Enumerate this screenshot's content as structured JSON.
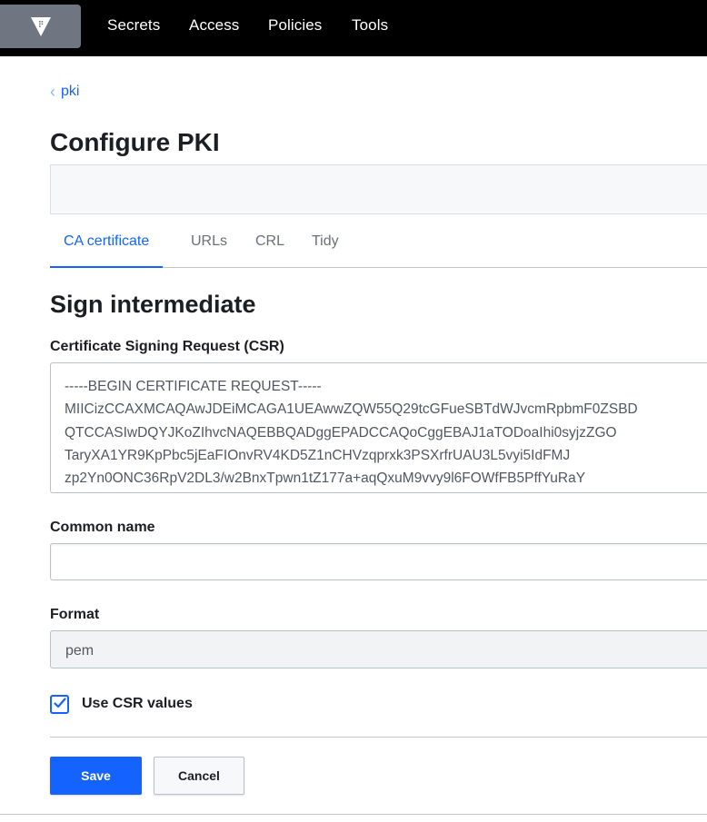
{
  "nav": {
    "logo_icon": "vault-logo-icon",
    "items": [
      {
        "label": "Secrets"
      },
      {
        "label": "Access"
      },
      {
        "label": "Policies"
      },
      {
        "label": "Tools"
      }
    ]
  },
  "breadcrumb": {
    "icon": "chevron-left-icon",
    "label": "pki"
  },
  "page": {
    "title": "Configure PKI"
  },
  "tabs": [
    {
      "label": "CA certificate",
      "active": true
    },
    {
      "label": "URLs",
      "active": false
    },
    {
      "label": "CRL",
      "active": false
    },
    {
      "label": "Tidy",
      "active": false
    }
  ],
  "form": {
    "title": "Sign intermediate",
    "csr": {
      "label": "Certificate Signing Request (CSR)",
      "lines": [
        "-----BEGIN CERTIFICATE REQUEST-----",
        "MIICizCCAXMCAQAwJDEiMCAGA1UEAwwZQW55Q29tcGFueSBTdWJvcmRpbmF0ZSBD",
        "QTCCASIwDQYJKoZIhvcNAQEBBQADggEPADCCAQoCggEBAJ1aTODoaIhi0syjzZGO",
        "TaryXA1YR9KpPbc5jEaFIOnvRV4KD5Z1nCHVzqprxk3PSXrfrUAU3L5vyi5IdFMJ",
        "zp2Yn0ONC36RpV2DL3/w2BnxTpwn1tZ177a+aqQxuM9vvy9l6FOWfFB5PffYuRaY"
      ]
    },
    "common_name": {
      "label": "Common name",
      "value": ""
    },
    "format": {
      "label": "Format",
      "value": "pem"
    },
    "use_csr_values": {
      "label": "Use CSR values",
      "checked": true,
      "icon": "checkmark-icon"
    },
    "save_label": "Save",
    "cancel_label": "Cancel"
  },
  "colors": {
    "accent": "#1563ff",
    "topbar": "#000000",
    "logo_bg": "#6f7682"
  }
}
